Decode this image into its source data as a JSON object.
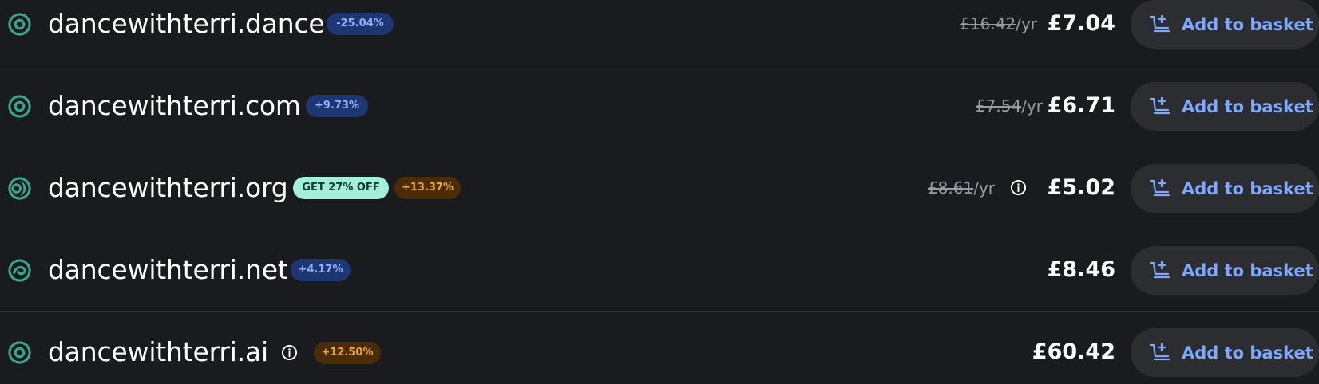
{
  "accent_color": "#7fa8ff",
  "tld_icon_color": "#3aa58f",
  "results": [
    {
      "domain": "dancewithterri.dance",
      "badges": [
        {
          "text": "-25.04%",
          "style": "blue"
        }
      ],
      "old_price": "£16.42",
      "per_year": "/yr",
      "price": "£7.04",
      "button_label": "Add to basket",
      "icon": "ring-icon"
    },
    {
      "domain": "dancewithterri.com",
      "badges": [
        {
          "text": "+9.73%",
          "style": "blue"
        }
      ],
      "old_price": "£7.54",
      "per_year": "/yr",
      "price": "£6.71",
      "button_label": "Add to basket",
      "icon": "ring-icon"
    },
    {
      "domain": "dancewithterri.org",
      "badges": [
        {
          "text": "GET 27% OFF",
          "style": "mint"
        },
        {
          "text": "+13.37%",
          "style": "orange"
        }
      ],
      "old_price": "£8.61",
      "per_year": "/yr",
      "has_info_icon": true,
      "price": "£5.02",
      "button_label": "Add to basket",
      "icon": "crescent-ring-icon"
    },
    {
      "domain": "dancewithterri.net",
      "badges": [
        {
          "text": "+4.17%",
          "style": "blue"
        }
      ],
      "price": "£8.46",
      "button_label": "Add to basket",
      "icon": "swirl-ring-icon"
    },
    {
      "domain": "dancewithterri.ai",
      "has_info_icon": true,
      "badges": [
        {
          "text": "+12.50%",
          "style": "orange"
        }
      ],
      "price": "£60.42",
      "button_label": "Add to basket",
      "icon": "ring-icon"
    }
  ]
}
